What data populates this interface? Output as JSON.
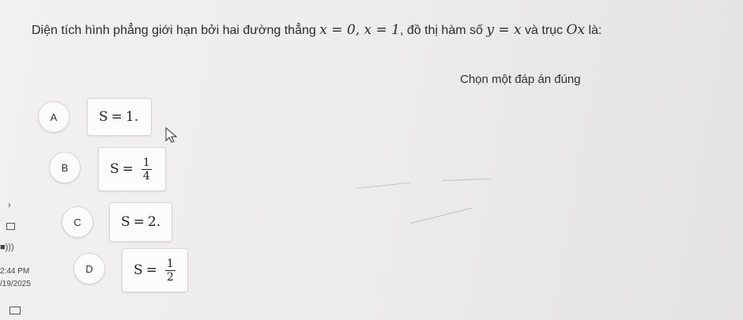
{
  "question": {
    "prefix": "Diện tích hình phẳng giới hạn bởi hai đường thẳng ",
    "m1": "x = 0, x = 1",
    "mid": ", đồ thị hàm số ",
    "m2": "y = x",
    "mid2": " và trục ",
    "m3": "Ox",
    "suffix": " là:"
  },
  "prompt": "Chọn một đáp án đúng",
  "options": [
    {
      "letter": "A",
      "lhs": "S",
      "value": "1."
    },
    {
      "letter": "B",
      "lhs": "S",
      "numerator": "1",
      "denominator": "4"
    },
    {
      "letter": "C",
      "lhs": "S",
      "value": "2."
    },
    {
      "letter": "D",
      "lhs": "S",
      "numerator": "1",
      "denominator": "2"
    }
  ],
  "taskbar": {
    "time": "2:44 PM",
    "date": "/19/2025"
  }
}
